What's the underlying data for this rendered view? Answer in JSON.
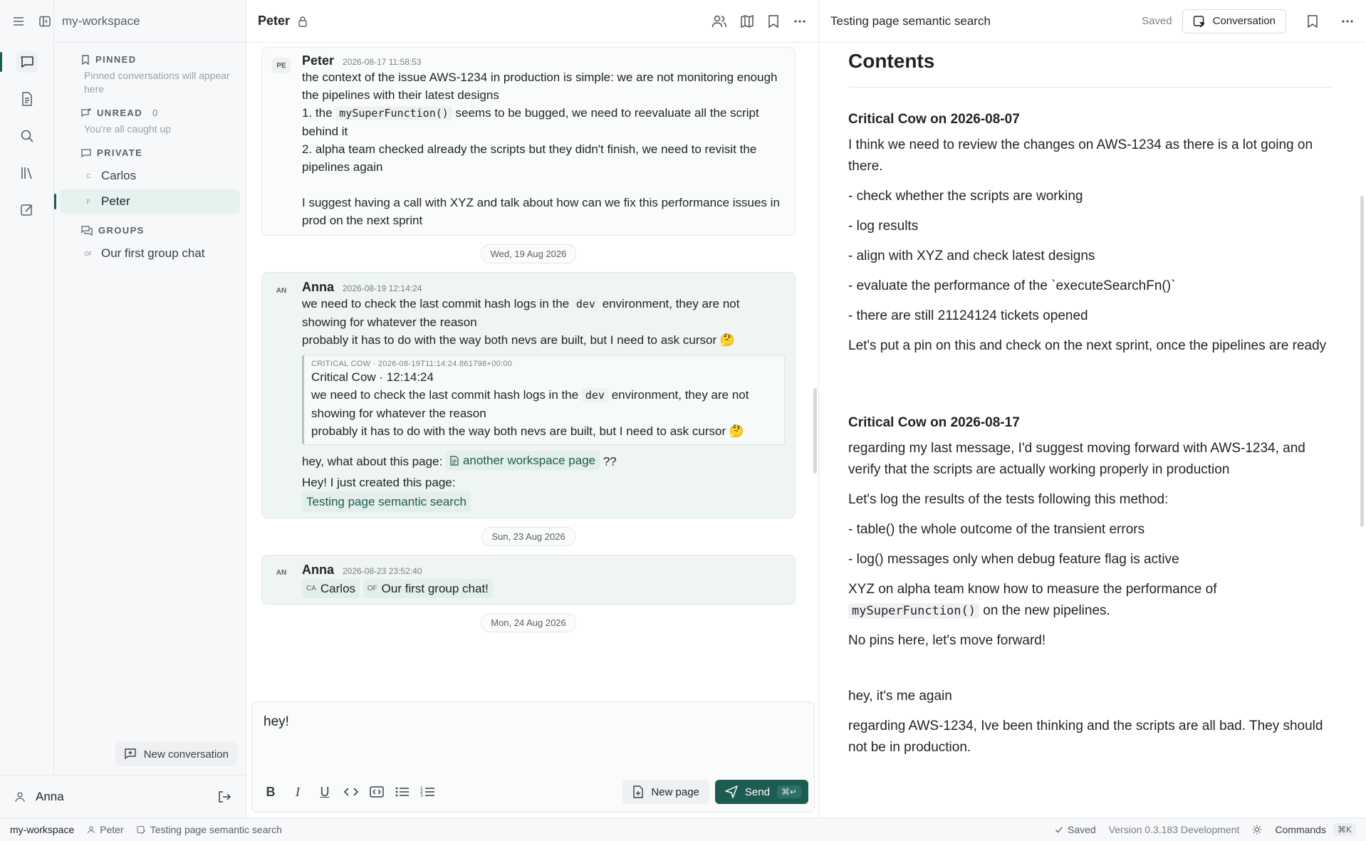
{
  "workspace": "my-workspace",
  "sidebar": {
    "pinned": {
      "label": "PINNED",
      "note": "Pinned conversations will appear here"
    },
    "unread": {
      "label": "UNREAD",
      "count": "0",
      "note": "You're all caught up"
    },
    "private": {
      "label": "PRIVATE",
      "items": [
        {
          "mini": "C",
          "name": "Carlos"
        },
        {
          "mini": "P",
          "name": "Peter"
        }
      ]
    },
    "groups": {
      "label": "GROUPS",
      "items": [
        {
          "mini": "OF",
          "name": "Our first group chat"
        }
      ]
    },
    "new_conversation": "New conversation",
    "user": "Anna"
  },
  "chat": {
    "title": "Peter",
    "messages": {
      "m1": {
        "avatar": "PE",
        "author": "Peter",
        "time": "2026-08-17 11:58:53",
        "l1": "the context of the issue AWS-1234 in production is simple: we are not monitoring enough the pipelines with their latest designs",
        "l2a": "1. the ",
        "l2code": "mySuperFunction()",
        "l2b": " seems to be bugged, we need to reevaluate all the script behind it",
        "l3": "2. alpha team checked already the scripts but they didn't finish, we need to revisit the pipelines again",
        "l4": "I suggest having a call with XYZ and talk about how can we fix this performance issues in prod on the next sprint"
      },
      "date1": "Wed, 19 Aug 2026",
      "m2": {
        "avatar": "AN",
        "author": "Anna",
        "time": "2026-08-19 12:14:24",
        "l1a": "we need to check the last commit hash logs in the ",
        "l1code": "dev",
        "l1b": " environment, they are not showing for whatever the reason",
        "l2": "probably it has to do with the way both nevs are built, but I need to ask cursor 🤔",
        "quote_meta": "CRITICAL COW · 2026-08-19T11:14:24.861798+00:00",
        "quote_title": "Critical Cow · 12:14:24",
        "quote_l1a": "we need to check the last commit hash logs in the ",
        "quote_l1code": "dev",
        "quote_l1b": " environment, they are not showing for whatever the reason",
        "quote_l2": "probably it has to do with the way both nevs are built, but I need to ask cursor 🤔",
        "l3a": "hey, what about this page: ",
        "l3chip": "another workspace page",
        "l3b": " ??",
        "l4": "Hey! I just created this page:",
        "l4chip": "Testing page semantic search"
      },
      "date2": "Sun, 23 Aug 2026",
      "m3": {
        "avatar": "AN",
        "author": "Anna",
        "time": "2026-08-23 23:52:40",
        "chip1_mini": "CA",
        "chip1": "Carlos",
        "chip2_mini": "OF",
        "chip2": "Our first group chat!"
      },
      "date3": "Mon, 24 Aug 2026"
    },
    "composer": {
      "text": "hey!",
      "new_page": "New page",
      "send": "Send",
      "send_kbd": "⌘↵"
    }
  },
  "doc": {
    "title": "Testing page semantic search",
    "saved": "Saved",
    "conversation_btn": "Conversation",
    "heading": "Contents",
    "s1": {
      "title": "Critical Cow on 2026-08-07",
      "p1": "I think we need to review the changes on AWS-1234 as there is a lot going on there.",
      "p2": "- check whether the scripts are working",
      "p3": "- log results",
      "p4": "- align with XYZ and check latest designs",
      "p5": "- evaluate the performance of the `executeSearchFn()`",
      "p6": "- there are still 21124124 tickets opened",
      "p7": "Let's put a pin on this and check on the next sprint, once the pipelines are ready"
    },
    "s2": {
      "title": "Critical Cow on 2026-08-17",
      "p1": "regarding my last message, I'd suggest moving forward with AWS-1234, and verify that the scripts are actually working properly in production",
      "p2": "Let's log the results of the tests following this method:",
      "p3": "- table() the whole outcome of the transient errors",
      "p4": "- log() messages only when debug feature flag is active",
      "p5a": "XYZ on alpha team know how to measure the performance of ",
      "p5code": "mySuperFunction()",
      "p5b": " on the new pipelines.",
      "p6": "No pins here, let's move forward!",
      "p7": "hey, it's me again",
      "p8": "regarding AWS-1234, Ive been thinking and the scripts are all bad. They should not be in production."
    }
  },
  "status": {
    "workspace": "my-workspace",
    "conversation": "Peter",
    "page": "Testing page semantic search",
    "saved": "Saved",
    "version": "Version 0.3.183 Development",
    "commands": "Commands",
    "commands_kbd": "⌘K"
  },
  "colors": {
    "accent": "#1d5c52",
    "highlight": "#eef5f3"
  }
}
